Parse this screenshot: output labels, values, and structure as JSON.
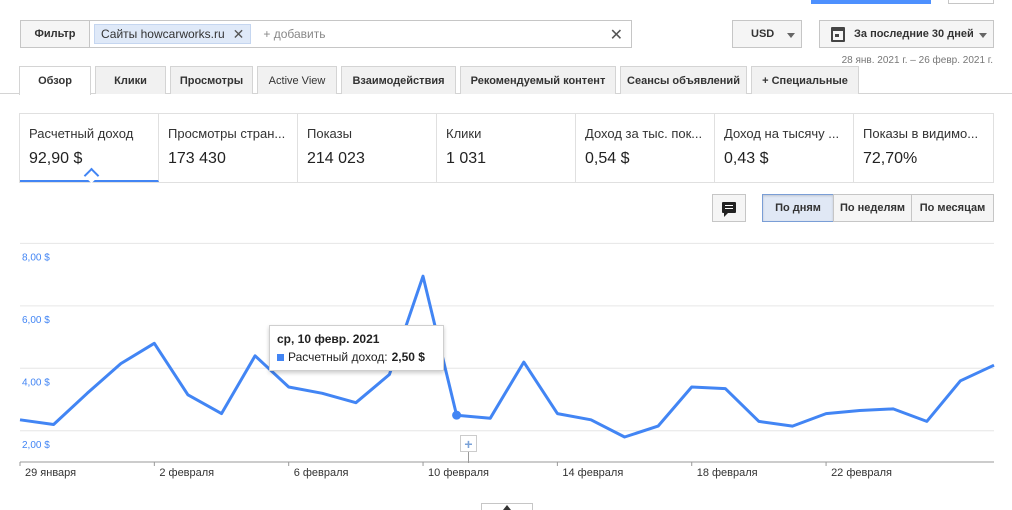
{
  "toolbar": {
    "filter_label": "Фильтр",
    "filter_chip": "Сайты howcarworks.ru",
    "add_placeholder": "+ добавить",
    "currency": "USD",
    "date_label": "За последние 30 дней",
    "date_range": "28 янв. 2021 г. – 26 февр. 2021 г."
  },
  "tabs": [
    {
      "label": "Обзор"
    },
    {
      "label": "Клики"
    },
    {
      "label": "Просмотры"
    },
    {
      "label": "Active View"
    },
    {
      "label": "Взаимодействия"
    },
    {
      "label": "Рекомендуемый контент"
    },
    {
      "label": "Сеансы объявлений"
    },
    {
      "label": "+  Специальные"
    }
  ],
  "metrics": [
    {
      "label": "Расчетный доход",
      "value": "92,90 $"
    },
    {
      "label": "Просмотры стран...",
      "value": "173 430"
    },
    {
      "label": "Показы",
      "value": "214 023"
    },
    {
      "label": "Клики",
      "value": "1 031"
    },
    {
      "label": "Доход за тыс. пок...",
      "value": "0,54 $"
    },
    {
      "label": "Доход на тысячу ...",
      "value": "0,43 $"
    },
    {
      "label": "Показы в видимо...",
      "value": "72,70%"
    }
  ],
  "period": {
    "day": "По дням",
    "week": "По неделям",
    "month": "По месяцам"
  },
  "tooltip": {
    "date": "ср, 10 февр. 2021",
    "label": "Расчетный доход:",
    "value": "2,50 $"
  },
  "colors": {
    "accent": "#4285f4",
    "grid": "#e6e6e6"
  },
  "chart_data": {
    "type": "line",
    "x": [
      "29 января",
      "30 января",
      "31 января",
      "1 февраля",
      "2 февраля",
      "3 февраля",
      "4 февраля",
      "5 февраля",
      "6 февраля",
      "7 февраля",
      "8 февраля",
      "9 февраля",
      "10 февраля",
      "11 февраля",
      "12 февраля",
      "13 февраля",
      "14 февраля",
      "15 февраля",
      "16 февраля",
      "17 февраля",
      "18 февраля",
      "19 февраля",
      "20 февраля",
      "21 февраля",
      "22 февраля",
      "23 февраля",
      "24 февраля",
      "25 февраля",
      "26 февраля"
    ],
    "series": [
      {
        "name": "Расчетный доход",
        "values": [
          2.35,
          2.2,
          3.2,
          4.15,
          4.8,
          3.15,
          2.55,
          4.4,
          3.4,
          3.2,
          2.9,
          3.8,
          6.95,
          2.5,
          2.4,
          4.2,
          2.55,
          2.35,
          1.8,
          2.15,
          3.4,
          3.35,
          2.3,
          2.15,
          2.55,
          2.65,
          2.7,
          2.3,
          3.6,
          4.1
        ]
      }
    ],
    "y_ticks": [
      "2,00 $",
      "4,00 $",
      "6,00 $",
      "8,00 $"
    ],
    "y_tick_values": [
      2,
      4,
      6,
      8
    ],
    "x_ticks": [
      "29 января",
      "2 февраля",
      "6 февраля",
      "10 февраля",
      "14 февраля",
      "18 февраля",
      "22 февраля"
    ],
    "ylim": [
      1.0,
      8.3
    ],
    "grid": true,
    "highlight_index": 13
  }
}
